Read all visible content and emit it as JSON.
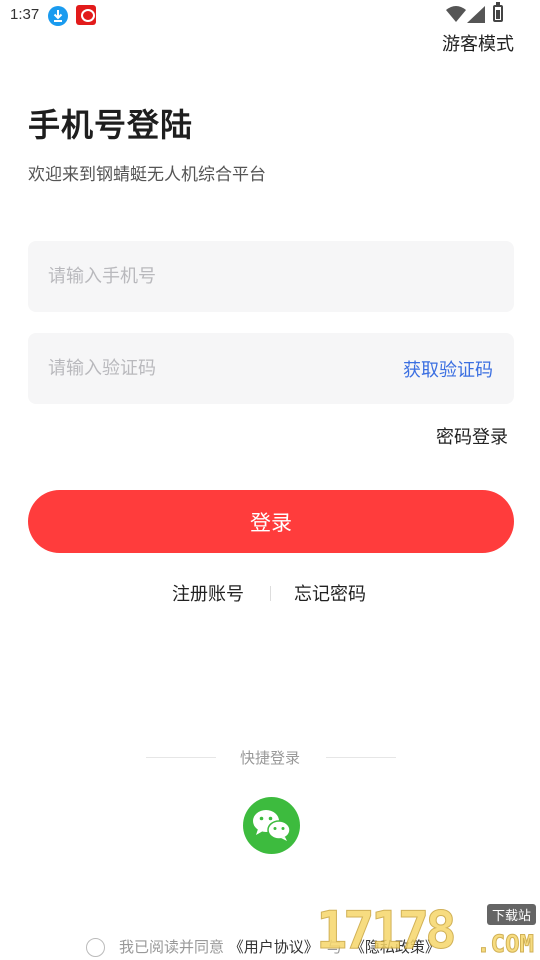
{
  "status_bar": {
    "time": "1:37"
  },
  "header": {
    "guest_mode_label": "游客模式"
  },
  "main": {
    "title": "手机号登陆",
    "subtitle": "欢迎来到钢蜻蜓无人机综合平台",
    "phone_input": {
      "placeholder": "请输入手机号",
      "value": ""
    },
    "code_input": {
      "placeholder": "请输入验证码",
      "value": ""
    },
    "get_code_label": "获取验证码",
    "password_login_label": "密码登录",
    "login_button_label": "登录",
    "register_label": "注册账号",
    "forgot_password_label": "忘记密码"
  },
  "quick_login": {
    "label": "快捷登录",
    "wechat_icon": "wechat-icon"
  },
  "agreement": {
    "prefix": "我已阅读并同意",
    "user_agreement": "《用户协议》",
    "separator": "与",
    "privacy_policy": "《隐私政策》",
    "checked": false
  },
  "watermark": {
    "number": "17178",
    "tag": "下载站",
    "suffix": ".COM"
  },
  "colors": {
    "primary_red": "#ff3c3c",
    "link_blue": "#3b6fe1",
    "wechat_green": "#3dbb3e",
    "input_bg": "#f6f6f7"
  }
}
